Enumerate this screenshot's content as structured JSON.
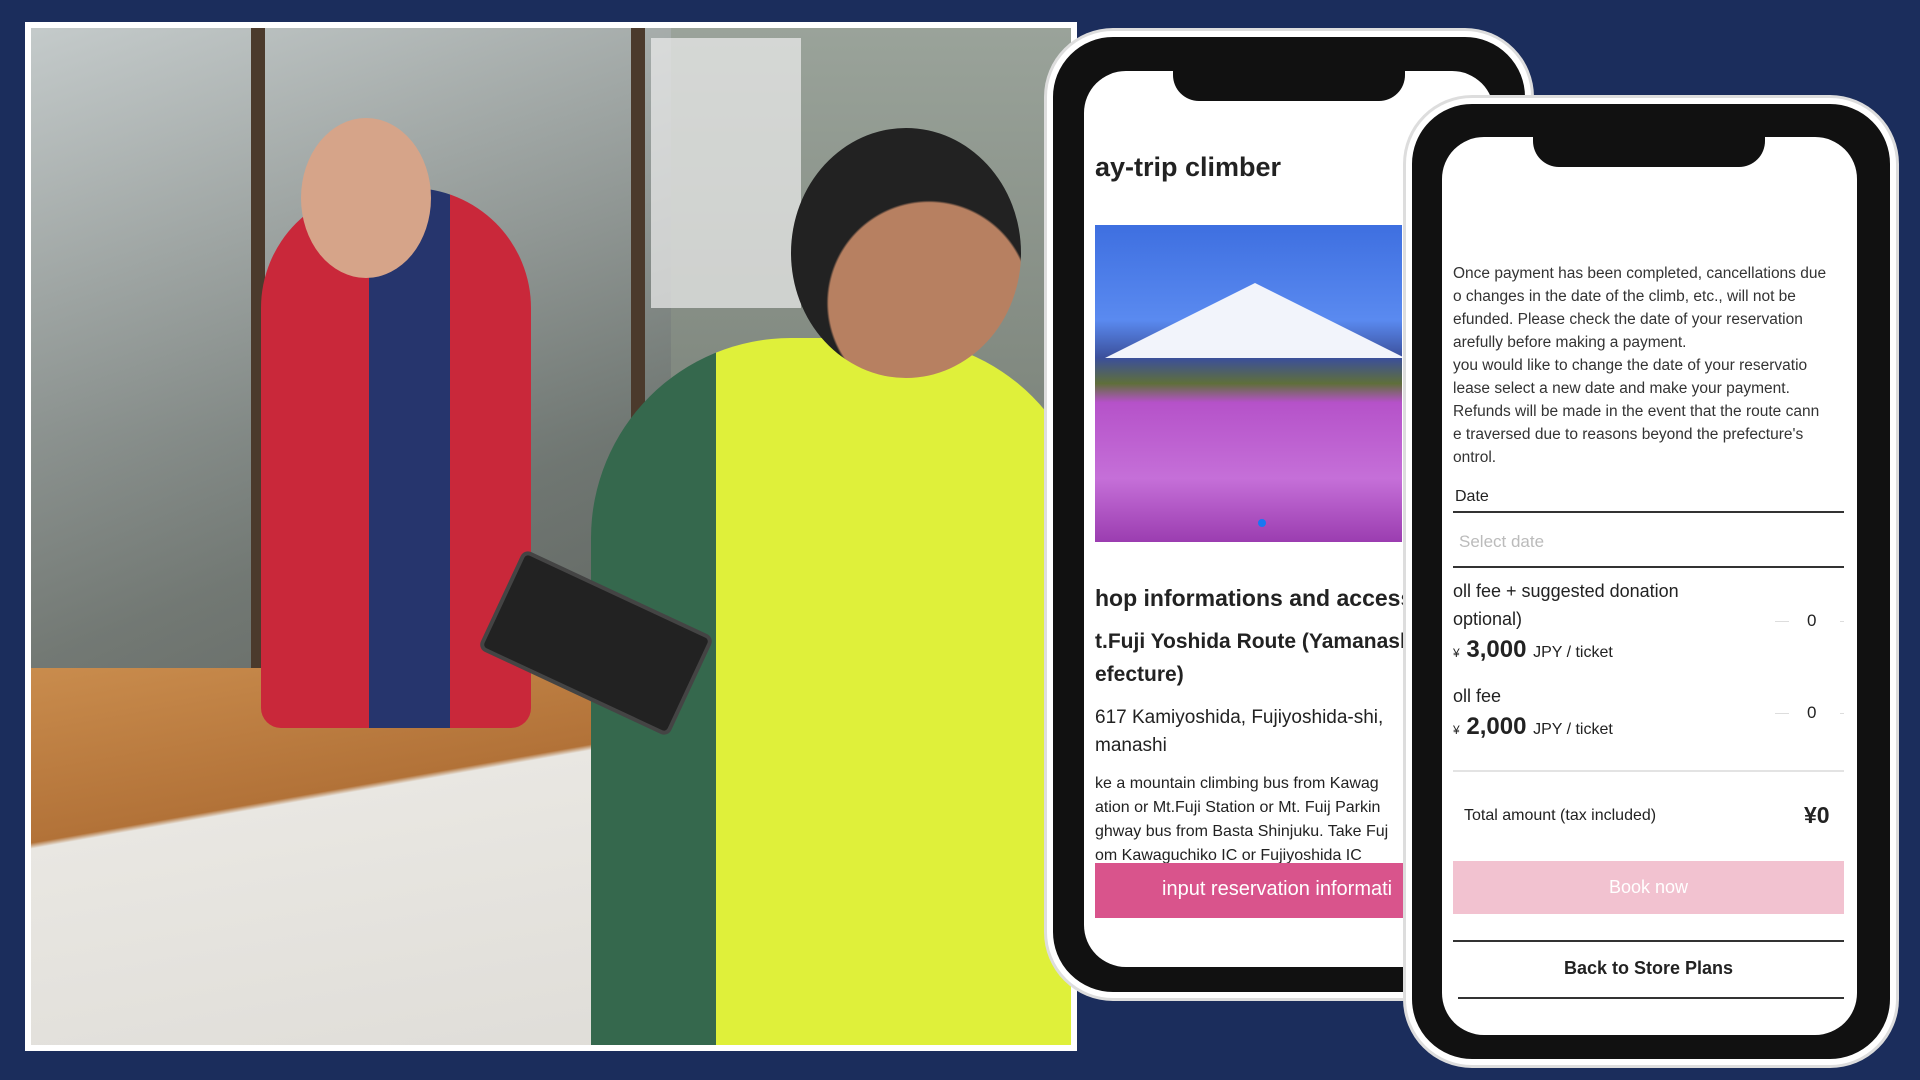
{
  "phone1": {
    "title": "ay-trip climber",
    "section_heading": "hop informations and access",
    "route_line1": "t.Fuji Yoshida Route (Yamanash",
    "route_line2": "efecture)",
    "address_line1": "617 Kamiyoshida, Fujiyoshida-shi,",
    "address_line2": "manashi",
    "access_lines": [
      "ke a mountain climbing bus from Kawag",
      "ation or Mt.Fuji Station or Mt. Fuij Parkin",
      "ghway bus from Basta Shinjuku. Take Fuj",
      "om Kawaguchiko IC or Fujiyoshida IC"
    ],
    "cta_label": "input reservation informati",
    "accent_color": "#d9548c"
  },
  "phone2": {
    "notice_lines": [
      "Once payment has been completed, cancellations due",
      "o changes in the date of the climb, etc., will not be",
      "efunded. Please check the date of your reservation",
      "arefully before making a payment.",
      " you would like to change the date of your reservatio",
      "lease select a new date and make your payment.",
      "Refunds will be made in the event that the route cann",
      "e traversed due to reasons beyond the prefecture's",
      "ontrol."
    ],
    "date_label": "Date",
    "date_placeholder": "Select date",
    "tickets": [
      {
        "name_line1": "oll fee + suggested donation",
        "name_line2": "optional)",
        "currency": "¥",
        "price": "3,000",
        "unit": "JPY / ticket",
        "quantity": "0"
      },
      {
        "name_line1": "oll fee",
        "name_line2": "",
        "currency": "¥",
        "price": "2,000",
        "unit": "JPY / ticket",
        "quantity": "0"
      }
    ],
    "total_label": "Total amount (tax included)",
    "total_value": "¥0",
    "book_label": "Book now",
    "book_color": "#f2c2d0",
    "back_label": "Back to Store Plans"
  },
  "background_color": "#1b2d5c"
}
